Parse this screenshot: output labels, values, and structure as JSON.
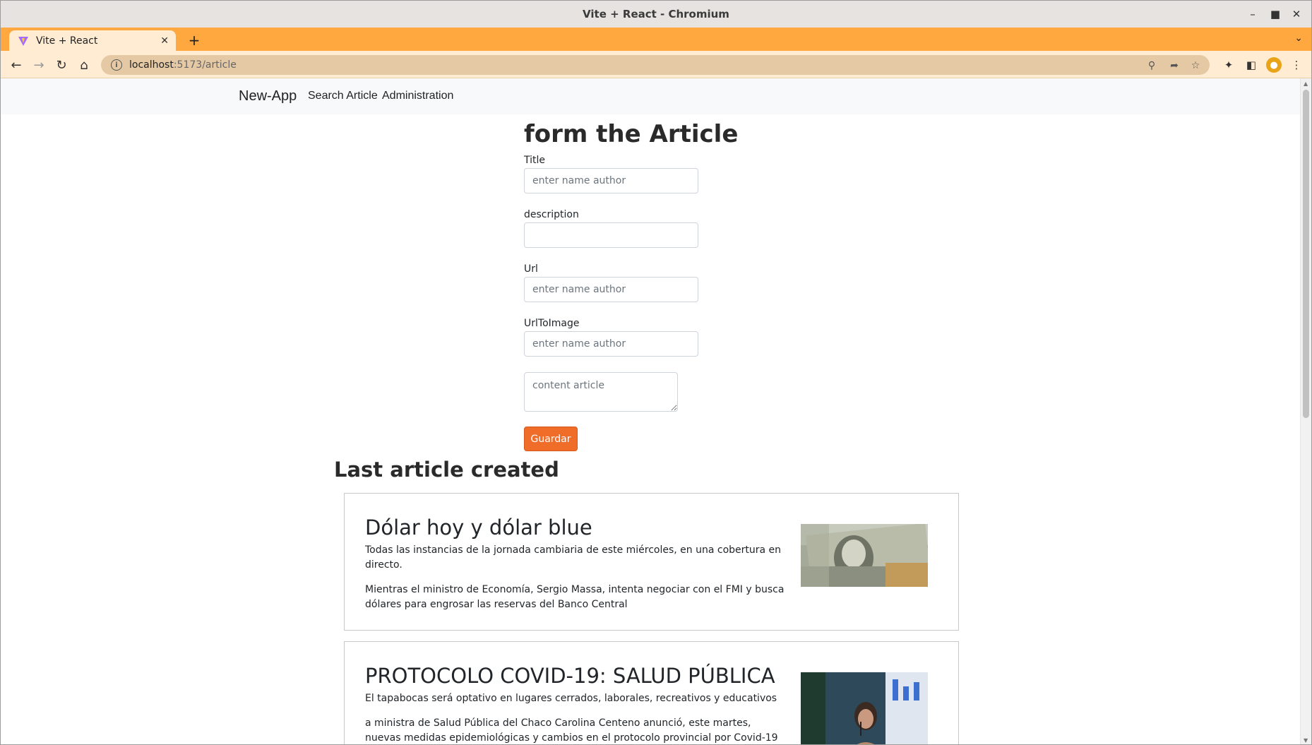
{
  "window": {
    "title": "Vite + React - Chromium"
  },
  "browser": {
    "tab_label": "Vite + React",
    "url_host": "localhost",
    "url_path": ":5173/article"
  },
  "nav": {
    "brand": "New-App",
    "links": [
      "Search Article",
      "Administration"
    ]
  },
  "form": {
    "heading": "form the Article",
    "fields": [
      {
        "label": "Title",
        "placeholder": "enter name author",
        "value": ""
      },
      {
        "label": "description",
        "placeholder": "",
        "value": ""
      },
      {
        "label": "Url",
        "placeholder": "enter name author",
        "value": ""
      },
      {
        "label": "UrlToImage",
        "placeholder": "enter name author",
        "value": ""
      }
    ],
    "content_placeholder": "content article",
    "submit_label": "Guardar"
  },
  "last_section": {
    "heading": "Last article created",
    "articles": [
      {
        "title": "Dólar hoy y dólar blue",
        "description": "Todas las instancias de la jornada cambiaria de este miércoles, en una cobertura en directo.",
        "content": "Mientras el ministro de Economía, Sergio Massa, intenta negociar con el FMI y busca dólares para engrosar las reservas del Banco Central",
        "image": "dollar-bills-photo"
      },
      {
        "title": "PROTOCOLO COVID-19: SALUD PÚBLICA",
        "description": "El tapabocas será optativo en lugares cerrados, laborales, recreativos y educativos",
        "content": "a ministra de Salud Pública del Chaco Carolina Centeno anunció, este martes, nuevas medidas epidemiológicas y cambios en el protocolo provincial por Covid-19",
        "image": "press-conference-photo"
      }
    ]
  },
  "colors": {
    "tab_strip": "#ffa83f",
    "toolbar": "#ffecd3",
    "accent_button": "#f06d29"
  }
}
